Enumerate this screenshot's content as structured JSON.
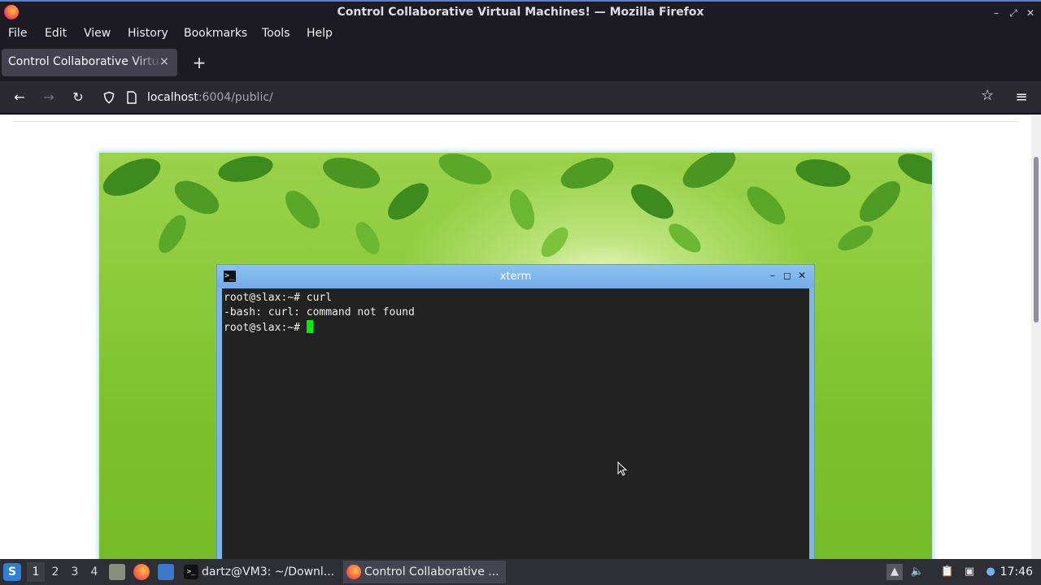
{
  "window": {
    "title": "Control Collaborative Virtual Machines! — Mozilla Firefox"
  },
  "menu": [
    "File",
    "Edit",
    "View",
    "History",
    "Bookmarks",
    "Tools",
    "Help"
  ],
  "tab": {
    "title": "Control Collaborative Virtual Machines!",
    "close": "×",
    "new_tab": "+"
  },
  "url": {
    "host": "localhost",
    "rest": ":6004/public/"
  },
  "xterm": {
    "title": "xterm",
    "lines": [
      "root@slax:~# curl",
      "-bash: curl: command not found",
      "root@slax:~# "
    ]
  },
  "taskbar": {
    "workspaces": [
      "1",
      "2",
      "3",
      "4"
    ],
    "tasks": [
      "dartz@VM3: ~/Downl...",
      "Control Collaborative ..."
    ],
    "clock": "17:46"
  },
  "colors": {
    "accent": "#5a7fd1",
    "cursor": "#00ee00",
    "xterm_title": "#7eb6e8"
  }
}
